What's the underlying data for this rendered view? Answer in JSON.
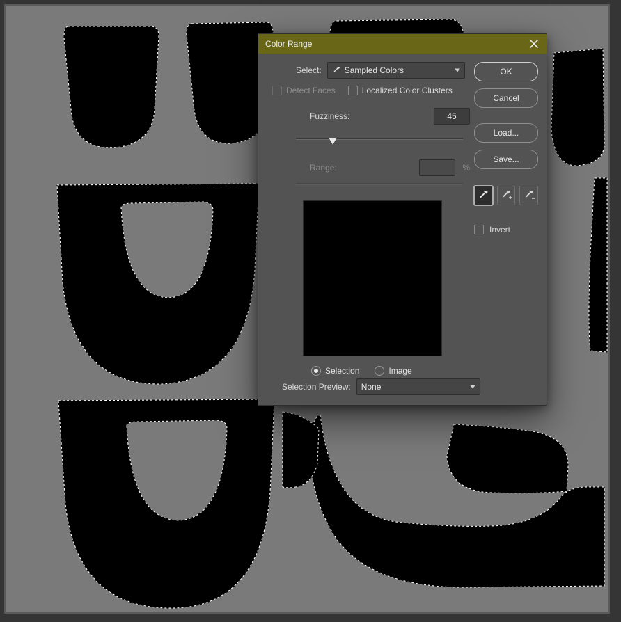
{
  "dialog": {
    "title": "Color Range",
    "select_label": "Select:",
    "select_value": "Sampled Colors",
    "detect_faces_label": "Detect Faces",
    "localized_label": "Localized Color Clusters",
    "fuzziness_label": "Fuzziness:",
    "fuzziness_value": "45",
    "range_label": "Range:",
    "range_value": "",
    "range_unit": "%",
    "preview_mode_selection": "Selection",
    "preview_mode_image": "Image",
    "selection_preview_label": "Selection Preview:",
    "selection_preview_value": "None",
    "buttons": {
      "ok": "OK",
      "cancel": "Cancel",
      "load": "Load...",
      "save": "Save..."
    },
    "invert_label": "Invert"
  },
  "slider": {
    "fuzziness_pos_pct": 22
  }
}
